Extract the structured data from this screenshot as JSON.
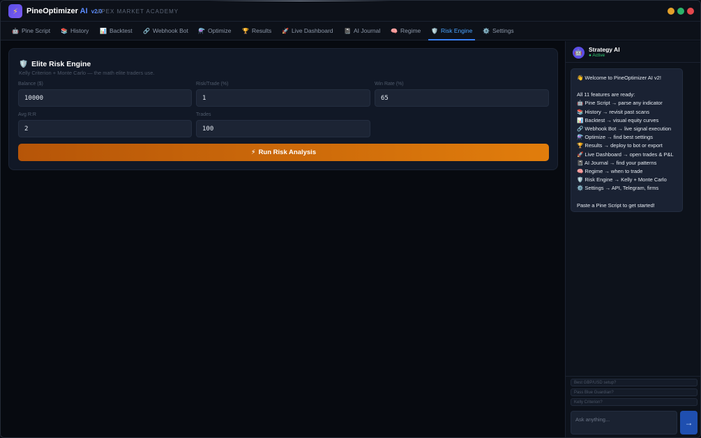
{
  "app": {
    "logo_glyph": "⚡",
    "name": "PineOptimizer",
    "name_ai": "AI",
    "version": "v2.0",
    "subtitle": "APEX MARKET ACADEMY"
  },
  "tabs": [
    {
      "icon": "🤖",
      "label": "Pine Script"
    },
    {
      "icon": "📚",
      "label": "History"
    },
    {
      "icon": "📊",
      "label": "Backtest"
    },
    {
      "icon": "🔗",
      "label": "Webhook Bot"
    },
    {
      "icon": "⚗️",
      "label": "Optimize"
    },
    {
      "icon": "🏆",
      "label": "Results"
    },
    {
      "icon": "🚀",
      "label": "Live Dashboard"
    },
    {
      "icon": "📓",
      "label": "AI Journal"
    },
    {
      "icon": "🧠",
      "label": "Regime"
    },
    {
      "icon": "🛡️",
      "label": "Risk Engine"
    },
    {
      "icon": "⚙️",
      "label": "Settings"
    }
  ],
  "active_tab": "Risk Engine",
  "risk": {
    "icon": "🛡️",
    "title": "Elite Risk Engine",
    "subtitle": "Kelly Criterion + Monte Carlo — the math elite traders use.",
    "fields": {
      "balance": {
        "label": "Balance ($)",
        "value": "10000"
      },
      "risk_trade": {
        "label": "Risk/Trade (%)",
        "value": "1"
      },
      "win_rate": {
        "label": "Win Rate (%)",
        "value": "65"
      },
      "avg_rr": {
        "label": "Avg R:R",
        "value": "2"
      },
      "trades": {
        "label": "Trades",
        "value": "100"
      }
    },
    "run_icon": "⚡",
    "run_label": "Run Risk Analysis"
  },
  "chat": {
    "avatar": "🤖",
    "name": "Strategy AI",
    "status": "● Active",
    "welcome": "👋 Welcome to PineOptimizer AI v2!",
    "ready": "All 11 features are ready:",
    "features": [
      "🤖 Pine Script → parse any indicator",
      "📚 History → revisit past scans",
      "📊 Backtest → visual equity curves",
      "🔗 Webhook Bot → live signal execution",
      "⚗️ Optimize → find best settings",
      "🏆 Results → deploy to bot or export",
      "🚀 Live Dashboard → open trades & P&L",
      "📓 AI Journal → find your patterns",
      "🧠 Regime → when to trade",
      "🛡️ Risk Engine → Kelly + Monte Carlo",
      "⚙️ Settings → API, Telegram, firms"
    ],
    "closing": "Paste a Pine Script to get started!",
    "suggestions": [
      "Best GBP/USD setup?",
      "Pass Blue Guardian?",
      "Kelly Criterion?"
    ],
    "input_placeholder": "Ask anything...",
    "send_glyph": "→"
  },
  "colors": {
    "accent": "#3b82f6",
    "run_button_start": "#b65508",
    "run_button_end": "#e17d0c",
    "status_active": "#2fcf72"
  }
}
